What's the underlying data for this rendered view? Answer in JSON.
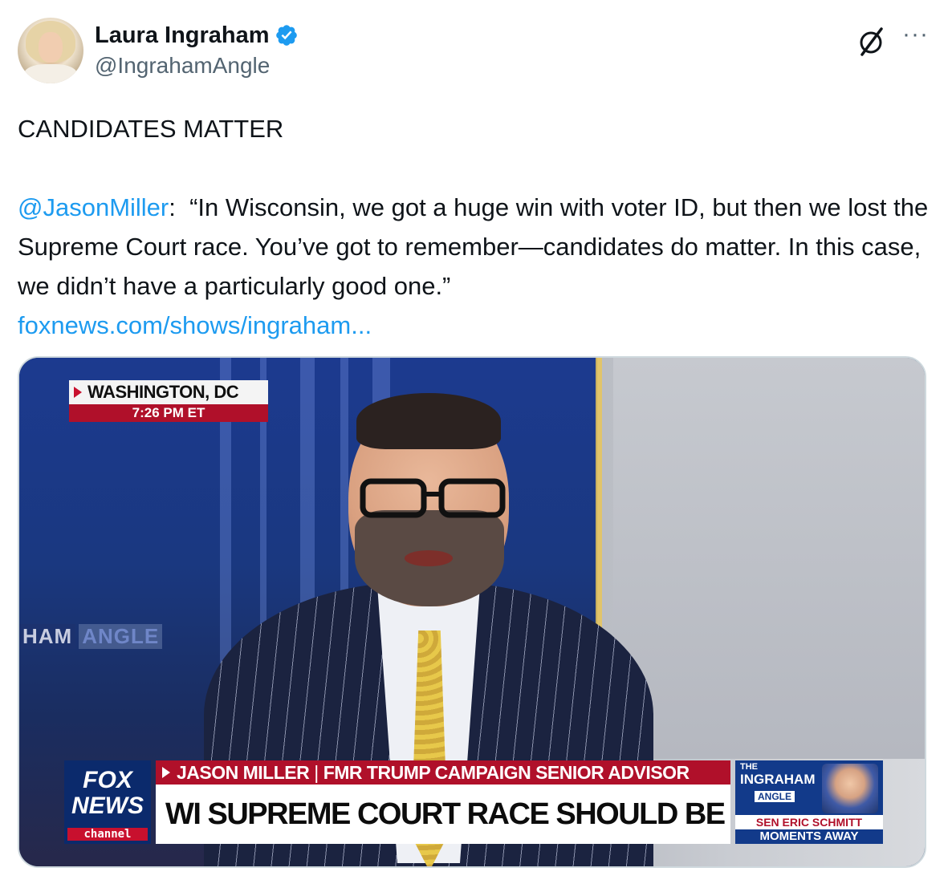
{
  "author": {
    "name": "Laura Ingraham",
    "handle": "@IngrahamAngle",
    "verified": true
  },
  "icons": {
    "verified": "verified-badge-icon",
    "grok": "grok-icon",
    "more": "more-options-icon"
  },
  "tweet": {
    "line1": "CANDIDATES MATTER",
    "mention": "@JasonMiller",
    "quote": ":  “In Wisconsin, we got a huge win with voter ID, but then we lost the Supreme Court race. You’ve got to remember—candidates do matter. In this case, we didn’t have a particularly good one.”",
    "link": "foxnews.com/shows/ingraham..."
  },
  "media": {
    "location": "WASHINGTON, DC",
    "time": "7:26 PM ET",
    "background_text_a": "HAM",
    "background_text_b": "ANGLE",
    "fox_logo_line1": "FOX",
    "fox_logo_line2": "NEWS",
    "fox_logo_line3": "channel",
    "guest_name": "JASON MILLER",
    "guest_title": "FMR TRUMP CAMPAIGN SENIOR ADVISOR",
    "headline": "WI SUPREME COURT RACE SHOULD BE WAKE-UP CALL",
    "show_the": "THE",
    "show_name": "INGRAHAM",
    "show_angle": "ANGLE",
    "promo_line1": "SEN ERIC SCHMITT",
    "promo_line2": "MOMENTS AWAY"
  },
  "colors": {
    "link": "#1d9bf0",
    "verified": "#1d9bf0",
    "fox_red": "#b0102a",
    "fox_blue": "#0b2a6c"
  }
}
